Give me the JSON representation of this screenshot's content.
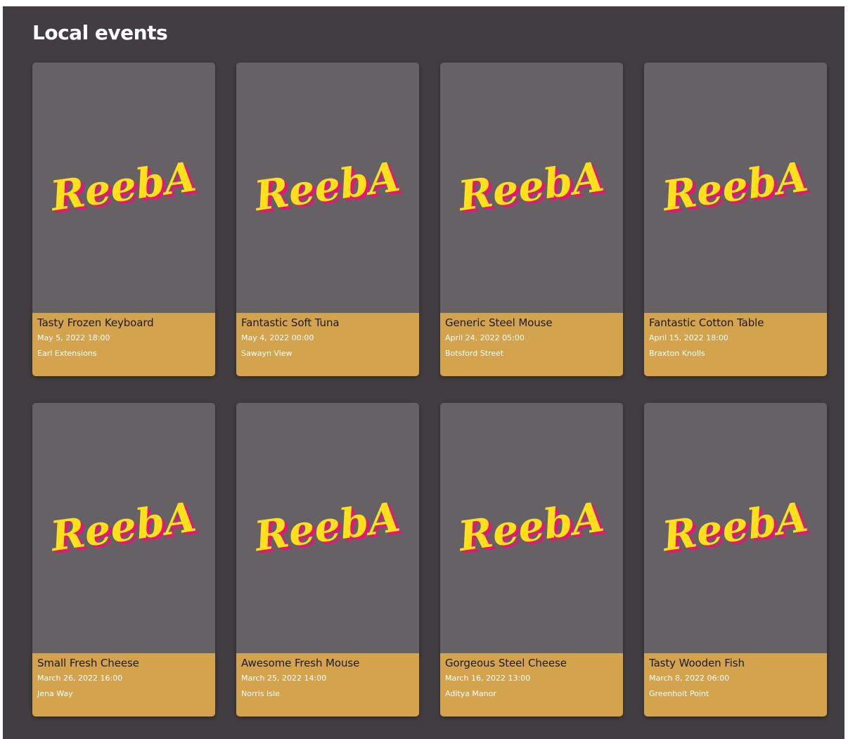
{
  "page": {
    "title": "Local events"
  },
  "colors": {
    "background": "#423d40",
    "card_image": "#666164",
    "card_info": "#d4a34e",
    "logo_fill": "#ffe01a",
    "logo_shadow": "#e6157a"
  },
  "events": [
    {
      "logo_text": "ReebA",
      "title": "Tasty Frozen Keyboard",
      "date": "May 5, 2022 18:00",
      "location": "Earl Extensions"
    },
    {
      "logo_text": "ReebA",
      "title": "Fantastic Soft Tuna",
      "date": "May 4, 2022 00:00",
      "location": "Sawayn View"
    },
    {
      "logo_text": "ReebA",
      "title": "Generic Steel Mouse",
      "date": "April 24, 2022 05:00",
      "location": "Botsford Street"
    },
    {
      "logo_text": "ReebA",
      "title": "Fantastic Cotton Table",
      "date": "April 15, 2022 18:00",
      "location": "Braxton Knolls"
    },
    {
      "logo_text": "ReebA",
      "title": "Small Fresh Cheese",
      "date": "March 26, 2022 16:00",
      "location": "Jena Way"
    },
    {
      "logo_text": "ReebA",
      "title": "Awesome Fresh Mouse",
      "date": "March 25, 2022 14:00",
      "location": "Norris Isle"
    },
    {
      "logo_text": "ReebA",
      "title": "Gorgeous Steel Cheese",
      "date": "March 16, 2022 13:00",
      "location": "Aditya Manor"
    },
    {
      "logo_text": "ReebA",
      "title": "Tasty Wooden Fish",
      "date": "March 8, 2022 06:00",
      "location": "Greenholt Point"
    }
  ]
}
